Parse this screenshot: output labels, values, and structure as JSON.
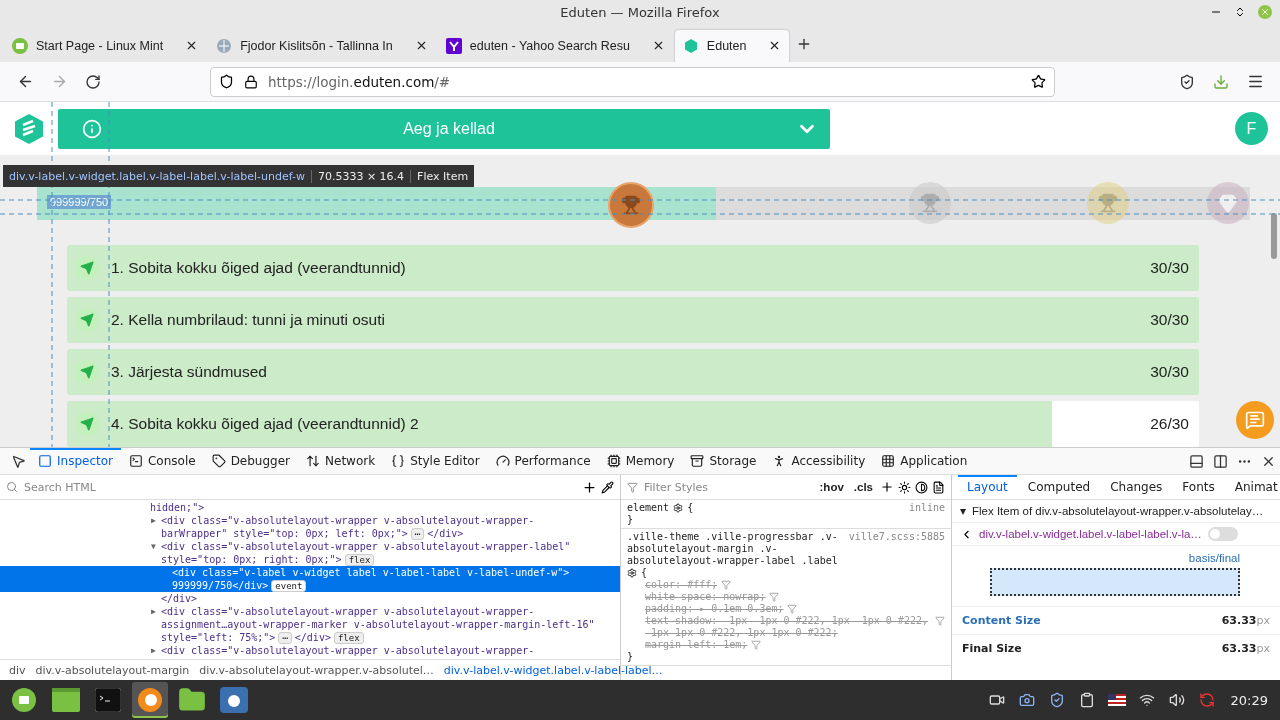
{
  "window": {
    "title": "Eduten — Mozilla Firefox"
  },
  "tabs": [
    {
      "kind": "mint",
      "title": "Start Page - Linux Mint",
      "selected": false
    },
    {
      "kind": "page",
      "title": "Fjodor Kislitsõn - Tallinna In",
      "selected": false
    },
    {
      "kind": "yahoo",
      "title": "eduten - Yahoo Search Resu",
      "selected": false
    },
    {
      "kind": "eduten",
      "title": "Eduten",
      "selected": true
    }
  ],
  "url": {
    "prefix": "https://login.",
    "domain": "eduten.com",
    "suffix": "/#"
  },
  "page": {
    "header": {
      "title": "Aeg ja kellad",
      "avatar": "F"
    },
    "inspector_tooltip": {
      "selector": "div.v-label.v-widget.label.v-label-label.v-label-undef-w",
      "size": "70.5333 × 16.4",
      "role": "Flex Item"
    },
    "progress": {
      "label": "999999/750",
      "level": 0.56,
      "markers": [
        {
          "kind": "bronze",
          "achieved": true
        },
        {
          "kind": "silver",
          "achieved": false
        },
        {
          "kind": "gold",
          "achieved": false
        },
        {
          "kind": "diamond",
          "achieved": false
        }
      ]
    },
    "assignments": [
      {
        "title": "1. Sobita kokku õiged ajad (veerandtunnid)",
        "score": "30/30",
        "level": 1
      },
      {
        "title": "2. Kella numbrilaud: tunni ja minuti osuti",
        "score": "30/30",
        "level": 1
      },
      {
        "title": "3. Järjesta sündmused",
        "score": "30/30",
        "level": 1
      },
      {
        "title": "4. Sobita kokku õiged ajad (veerandtunnid) 2",
        "score": "26/30",
        "level": 0.87
      }
    ]
  },
  "devtools": {
    "tabs": [
      {
        "kind": "inspector",
        "label": "Inspector",
        "selected": true
      },
      {
        "kind": "console",
        "label": "Console",
        "selected": false
      },
      {
        "kind": "debugger",
        "label": "Debugger",
        "selected": false
      },
      {
        "kind": "network",
        "label": "Network",
        "selected": false
      },
      {
        "kind": "style",
        "label": "Style Editor",
        "selected": false
      },
      {
        "kind": "performance",
        "label": "Performance",
        "selected": false
      },
      {
        "kind": "memory",
        "label": "Memory",
        "selected": false
      },
      {
        "kind": "storage",
        "label": "Storage",
        "selected": false
      },
      {
        "kind": "accessibility",
        "label": "Accessibility",
        "selected": false
      },
      {
        "kind": "application",
        "label": "Application",
        "selected": false
      }
    ],
    "search": {
      "placeholder": "Search HTML"
    },
    "tree": [
      {
        "selected": false,
        "lines": [
          [
            {
              "kind": "code",
              "text": "hidden;\">"
            }
          ]
        ],
        "children": [
          {
            "arrow": "▶",
            "selected": false,
            "lines": [
              [
                {
                  "kind": "code",
                  "text": "<div class=\"v-absolutelayout-wrapper v-absolutelayout-wrapper-"
                }
              ],
              [
                {
                  "kind": "code",
                  "text": "barWrapper\" style=\"top: 0px; left: 0px;\">"
                },
                {
                  "kind": "badge",
                  "text": "⋯"
                },
                {
                  "kind": "code",
                  "text": "</div>"
                }
              ]
            ]
          },
          {
            "arrow": "▼",
            "selected": false,
            "lines": [
              [
                {
                  "kind": "code",
                  "text": "<div class=\"v-absolutelayout-wrapper v-absolutelayout-wrapper-label\""
                }
              ],
              [
                {
                  "kind": "code",
                  "text": "style=\"top: 0px; right: 0px;\">"
                },
                {
                  "kind": "badge",
                  "text": "flex"
                }
              ]
            ],
            "closing": "</div>",
            "children": [
              {
                "selected": true,
                "lines": [
                  [
                    {
                      "kind": "code",
                      "text": "<div class=\"v-label v-widget label v-label-label v-label-undef-w\">"
                    }
                  ],
                  [
                    {
                      "kind": "code",
                      "text": "999999/750</div>"
                    },
                    {
                      "kind": "badge",
                      "text": "event"
                    }
                  ]
                ]
              }
            ]
          },
          {
            "arrow": "▶",
            "selected": false,
            "lines": [
              [
                {
                  "kind": "code",
                  "text": "<div class=\"v-absolutelayout-wrapper v-absolutelayout-wrapper-"
                }
              ],
              [
                {
                  "kind": "code",
                  "text": "assignment…ayout-wrapper-marker v-absolutelayout-wrapper-margin-left-16\""
                }
              ],
              [
                {
                  "kind": "code",
                  "text": "style=\"left: 75%;\">"
                },
                {
                  "kind": "badge",
                  "text": "⋯"
                },
                {
                  "kind": "code",
                  "text": "</div>"
                },
                {
                  "kind": "badge",
                  "text": "flex"
                }
              ]
            ]
          },
          {
            "arrow": "▶",
            "selected": false,
            "lines": [
              [
                {
                  "kind": "code",
                  "text": "<div class=\"v-absolutelayout-wrapper v-absolutelayout-wrapper-"
                }
              ]
            ]
          }
        ]
      }
    ],
    "breadcrumbs": [
      {
        "label": "div",
        "selected": false
      },
      {
        "label": "div.v-absolutelayout-margin",
        "selected": false
      },
      {
        "label": "div.v-absolutelayout-wrapper.v-absolutel…",
        "selected": false
      },
      {
        "label": "div.v-label.v-widget.label.v-label-label…",
        "selected": true
      }
    ],
    "rules": {
      "filter_placeholder": "Filter Styles",
      "buttons": [
        ":hov",
        ".cls"
      ],
      "items": [
        {
          "selector": "element",
          "open": "{",
          "close": "}",
          "source": "inline"
        },
        {
          "selector": ".ville-theme .ville-progressbar .v-absolutelayout-margin .v-absolutelayout-wrapper-label .label",
          "open": "{",
          "close": "}",
          "source": "ville7.scss:5885",
          "declarations": [
            {
              "text": "color: #fff;",
              "overridden": true
            },
            {
              "text": "white-space: nowrap;",
              "overridden": true
            },
            {
              "text": "padding: ▸ 0.1em 0.3em;",
              "overridden": true
            },
            {
              "text": "text-shadow: -1px -1px 0 #222, 1px -1px 0 #222, -1px 1px 0 #222, 1px 1px 0 #222;",
              "overridden": true
            },
            {
              "text": "margin-left: 1em;",
              "overridden": true
            }
          ]
        }
      ]
    },
    "layout": {
      "tabs": [
        {
          "label": "Layout",
          "selected": true
        },
        {
          "label": "Computed",
          "selected": false
        },
        {
          "label": "Changes",
          "selected": false
        },
        {
          "label": "Fonts",
          "selected": false
        },
        {
          "label": "Animat",
          "selected": false
        }
      ],
      "section_toggle": "▾",
      "section": "Flex Item of div.v-absolutelayout-wrapper.v-absolutelay…",
      "item": "div.v-label.v-widget.label.v-label-label.v-la…",
      "highlight_on": false,
      "basis_label": "basis/final",
      "sizes": [
        {
          "label": "Content Size",
          "value": "63.33",
          "unit": "px",
          "kind": "content"
        },
        {
          "label": "Final Size",
          "value": "63.33",
          "unit": "px",
          "kind": "final"
        }
      ]
    }
  },
  "taskbar": {
    "apps": [
      {
        "kind": "menu",
        "active": false
      },
      {
        "kind": "files",
        "active": false
      },
      {
        "kind": "terminal",
        "active": false
      },
      {
        "kind": "firefox",
        "active": true
      },
      {
        "kind": "folder",
        "active": false
      },
      {
        "kind": "screenshot",
        "active": false
      }
    ],
    "tray": [
      {
        "kind": "camera"
      },
      {
        "kind": "screenshot"
      },
      {
        "kind": "shield"
      },
      {
        "kind": "clipboard"
      },
      {
        "kind": "flag"
      },
      {
        "kind": "wifi"
      },
      {
        "kind": "volume"
      },
      {
        "kind": "update"
      }
    ],
    "clock": "20:29"
  }
}
